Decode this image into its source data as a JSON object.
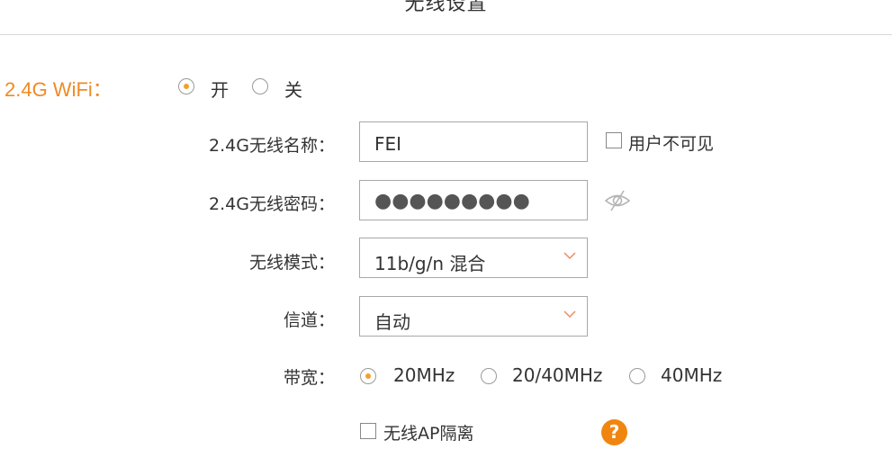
{
  "header": {
    "title": "无线设置"
  },
  "wifi24": {
    "section_label": "2.4G WiFi：",
    "power": {
      "on_label": "开",
      "off_label": "关",
      "selected": "开"
    }
  },
  "ssid": {
    "label": "2.4G无线名称：",
    "value": "FEI",
    "hidden_label": "用户不可见",
    "hidden_checked": false
  },
  "password": {
    "label": "2.4G无线密码：",
    "value": "●●●●●●●●●",
    "eye_icon": "eye-slash-icon"
  },
  "mode": {
    "label": "无线模式：",
    "value": "11b/g/n 混合"
  },
  "channel": {
    "label": "信道：",
    "value": "自动"
  },
  "bandwidth": {
    "label": "带宽：",
    "options": [
      "20MHz",
      "20/40MHz",
      "40MHz"
    ],
    "selected": "20MHz"
  },
  "ap_isolation": {
    "label": "无线AP隔离",
    "checked": false
  },
  "help": {
    "symbol": "?"
  },
  "colors": {
    "accent": "#f08a24",
    "radio_dot": "#f0a030",
    "help_bg": "#f0860f",
    "chevron": "#f08a60"
  }
}
